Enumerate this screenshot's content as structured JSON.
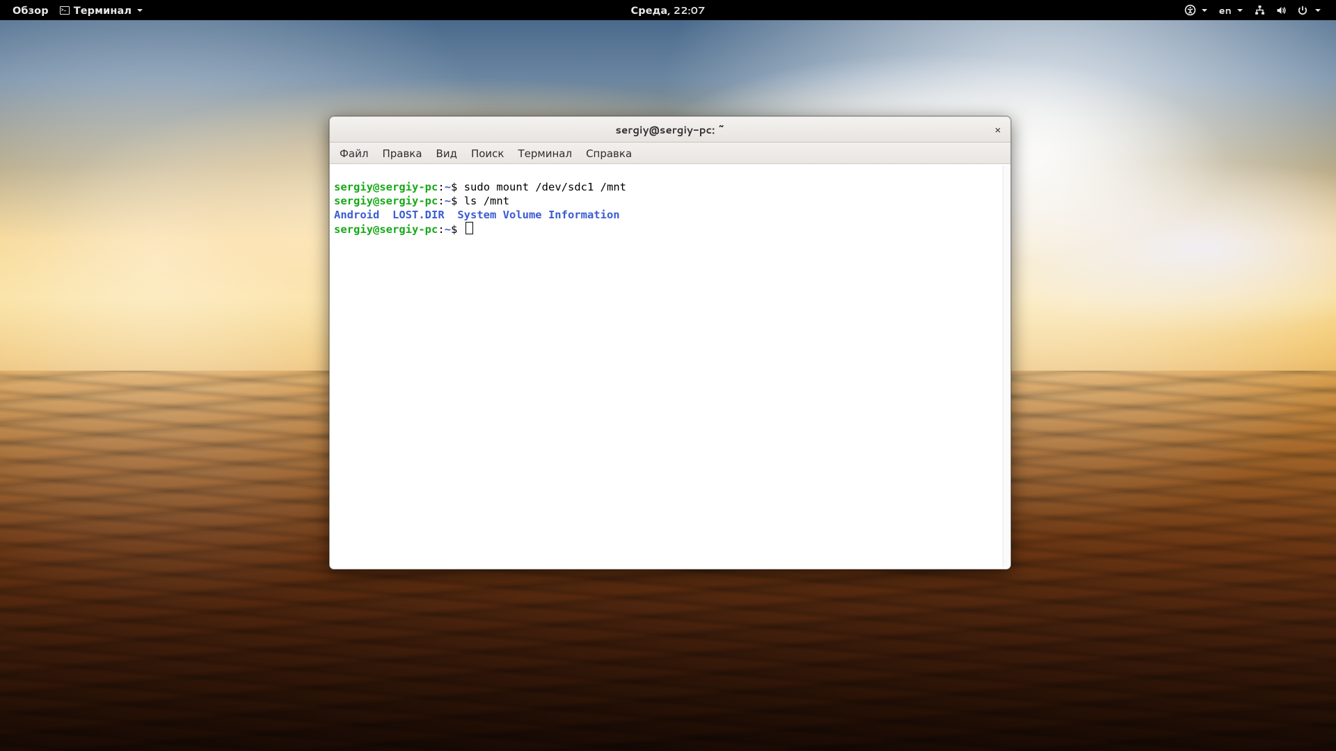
{
  "topbar": {
    "activities": "Обзор",
    "appmenu_label": "Терминал",
    "clock": "Среда, 22:07",
    "input_source": "en"
  },
  "window": {
    "title": "sergiy@sergiy-pc: ~",
    "close_glyph": "×",
    "menubar": {
      "file": "Файл",
      "edit": "Правка",
      "view": "Вид",
      "search": "Поиск",
      "terminal": "Терминал",
      "help": "Справка"
    }
  },
  "terminal": {
    "prompt": {
      "user": "sergiy",
      "at": "@",
      "host": "sergiy-pc",
      "colon": ":",
      "path": "~",
      "sigil": "$ "
    },
    "lines": {
      "cmd1": "sudo mount /dev/sdc1 /mnt",
      "cmd2": "ls /mnt",
      "out1_a": "Android",
      "out1_b": "LOST.DIR",
      "out1_c": "System Volume Information",
      "out1_sep1": "  ",
      "out1_sep2": "  "
    }
  }
}
